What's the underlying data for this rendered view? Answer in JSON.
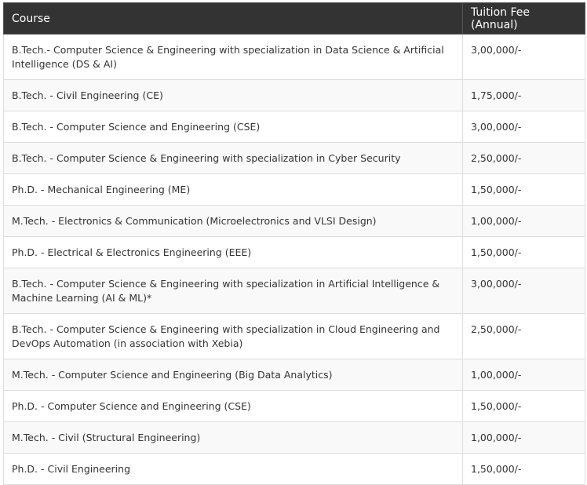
{
  "table": {
    "headers": {
      "course": "Course",
      "fee": "Tuition Fee (Annual)"
    },
    "rows": [
      {
        "course": "B.Tech.- Computer Science & Engineering with specialization in Data Science & Artificial Intelligence (DS & AI)",
        "fee": "3,00,000/-"
      },
      {
        "course": "B.Tech. - Civil Engineering (CE)",
        "fee": "1,75,000/-"
      },
      {
        "course": "B.Tech. - Computer Science and Engineering (CSE)",
        "fee": "3,00,000/-"
      },
      {
        "course": "B.Tech. - Computer Science & Engineering with specialization in Cyber Security",
        "fee": "2,50,000/-"
      },
      {
        "course": "Ph.D. - Mechanical Engineering (ME)",
        "fee": "1,50,000/-"
      },
      {
        "course": "M.Tech. - Electronics & Communication (Microelectronics and VLSI Design)",
        "fee": "1,00,000/-"
      },
      {
        "course": "Ph.D. - Electrical & Electronics Engineering (EEE)",
        "fee": "1,50,000/-"
      },
      {
        "course": "B.Tech. - Computer Science & Engineering with specialization in Artificial Intelligence & Machine Learning (AI & ML)*",
        "fee": "3,00,000/-"
      },
      {
        "course": "B.Tech. - Computer Science & Engineering with specialization in Cloud Engineering and DevOps Automation (in association with Xebia)",
        "fee": "2,50,000/-"
      },
      {
        "course": "M.Tech. - Computer Science and Engineering (Big Data Analytics)",
        "fee": "1,00,000/-"
      },
      {
        "course": "Ph.D. - Computer Science and Engineering (CSE)",
        "fee": "1,50,000/-"
      },
      {
        "course": "M.Tech. - Civil (Structural Engineering)",
        "fee": "1,00,000/-"
      },
      {
        "course": "Ph.D. - Civil Engineering",
        "fee": "1,50,000/-"
      }
    ]
  }
}
